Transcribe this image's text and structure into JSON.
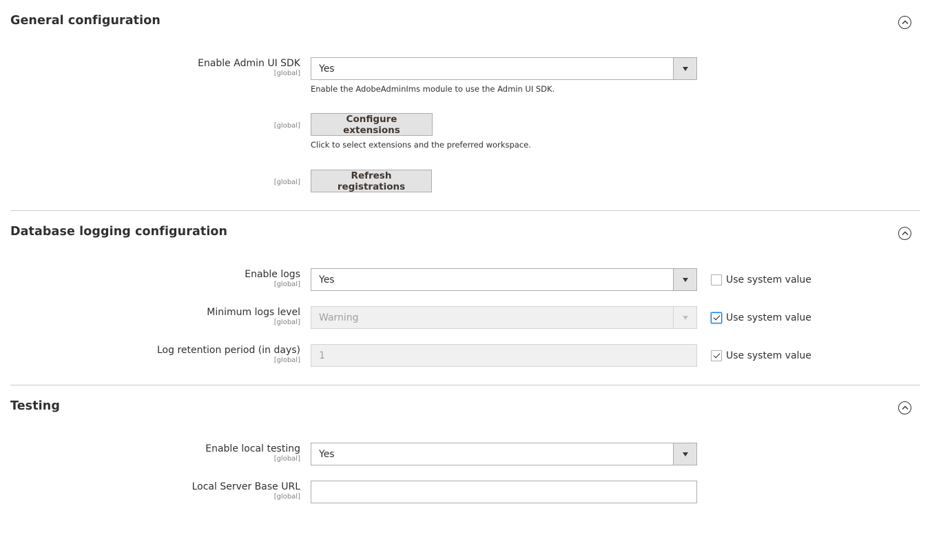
{
  "sections": {
    "general": {
      "title": "General configuration",
      "enable_admin_ui_sdk": {
        "label": "Enable Admin UI SDK",
        "scope": "[global]",
        "value": "Yes",
        "note": "Enable the AdobeAdminIms module to use the Admin UI SDK."
      },
      "configure_extensions": {
        "scope": "[global]",
        "button": "Configure extensions",
        "note": "Click to select extensions and the preferred workspace."
      },
      "refresh_registrations": {
        "scope": "[global]",
        "button": "Refresh registrations"
      }
    },
    "database_logging": {
      "title": "Database logging configuration",
      "enable_logs": {
        "label": "Enable logs",
        "scope": "[global]",
        "value": "Yes",
        "use_system_value": "Use system value",
        "use_system_checked": false
      },
      "minimum_logs_level": {
        "label": "Minimum logs level",
        "scope": "[global]",
        "value": "Warning",
        "use_system_value": "Use system value",
        "use_system_checked": true
      },
      "log_retention_period": {
        "label": "Log retention period (in days)",
        "scope": "[global]",
        "value": "1",
        "use_system_value": "Use system value",
        "use_system_checked": true
      }
    },
    "testing": {
      "title": "Testing",
      "enable_local_testing": {
        "label": "Enable local testing",
        "scope": "[global]",
        "value": "Yes"
      },
      "local_server_base_url": {
        "label": "Local Server Base URL",
        "scope": "[global]",
        "value": ""
      }
    }
  },
  "icons": {
    "collapse": "chevron-up-circle-icon",
    "select_arrow": "triangle-down-icon",
    "checkmark": "check-icon"
  }
}
